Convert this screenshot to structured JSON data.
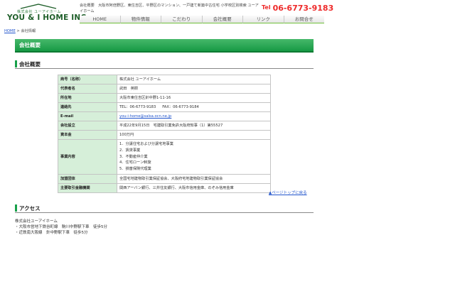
{
  "header": {
    "logo_sub": "株式会社 ユーアイホーム",
    "logo_main": "YOU & I HOME INC.",
    "tagline": "会社概要　大阪市阿倍野区、東住吉区、平野区のマンション、一戸建て新築中古住宅 小学校区別検索 ユーアイホーム",
    "tel_label": "Tel",
    "tel_number": "06-6773-9183"
  },
  "nav": [
    "HOME",
    "物件情報",
    "こだわり",
    "会社概要",
    "リンク",
    "お問合せ"
  ],
  "breadcrumb": {
    "home": "HOME",
    "sep": " > ",
    "current": "会社情報"
  },
  "banner_title": "会社概要",
  "section_company": "会社概要",
  "company_rows": [
    {
      "label": "商号（名称）",
      "value": "株式会社 ユーアイホーム"
    },
    {
      "label": "代表者名",
      "value": "武田　英樹"
    },
    {
      "label": "所在地",
      "value": "大阪市東住吉区針中野1-11-16"
    },
    {
      "label": "連絡先",
      "tel": "TEL：06-6773-9183",
      "fax": "FAX：06-6773-9184"
    },
    {
      "label": "E-mail",
      "value": "you-i-home@salsa.ocn.ne.jp"
    },
    {
      "label": "会社設立",
      "value": "平成22年9月15日　宅建取引業免許大阪府知事（1）第55527"
    },
    {
      "label": "資本金",
      "value": "100万円"
    },
    {
      "label": "事業内容",
      "items": [
        "1．分譲住宅および分譲宅地事業",
        "2．賃貸事業",
        "3．不動産仲介業",
        "4．住宅ローン斡旋",
        "5．損害保険代理業"
      ]
    },
    {
      "label": "加盟団体",
      "value": "全国宅地建物取引業保証協会、大阪府宅地建物取引業保証協会"
    },
    {
      "label": "主要取引金融機関",
      "value": "関西アーバン銀行、三井住友銀行、大阪市信用金庫、のぞみ信用金庫"
    }
  ],
  "page_top": "▲ページトップに戻る",
  "section_access": "アクセス",
  "access": {
    "company": "株式会社ユーアイホーム",
    "line1": "・大阪市営地下鉄谷町線　駒川中野駅下車　徒歩5分",
    "line2": "・近鉄南大阪線　針中野駅下車　徒歩5分"
  },
  "colors": {
    "accent_green": "#179a45",
    "tel_red": "#ee2a2a",
    "table_label_bg": "#d6efd9",
    "link_blue": "#2255cc"
  }
}
